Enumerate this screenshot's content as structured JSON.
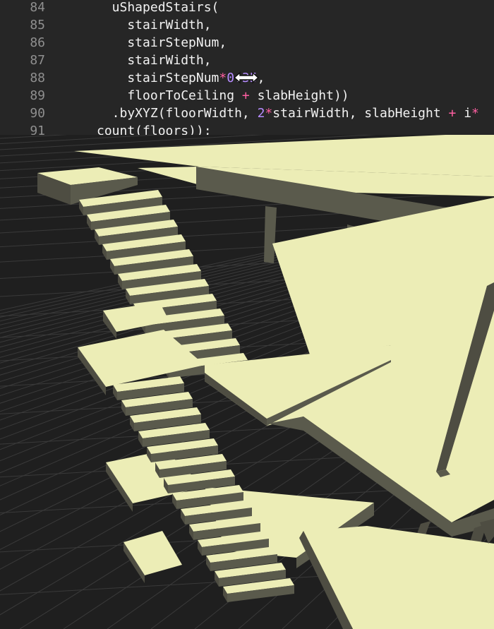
{
  "editor": {
    "lines": [
      {
        "num": "84",
        "tokens": [
          {
            "t": "  uShapedStairs(",
            "c": "plain"
          }
        ]
      },
      {
        "num": "85",
        "tokens": [
          {
            "t": "    stairWidth,",
            "c": "plain"
          }
        ]
      },
      {
        "num": "86",
        "tokens": [
          {
            "t": "    stairStepNum,",
            "c": "plain"
          }
        ]
      },
      {
        "num": "87",
        "tokens": [
          {
            "t": "    stairWidth,",
            "c": "plain"
          }
        ]
      },
      {
        "num": "88",
        "tokens": [
          {
            "t": "    stairStepNum",
            "c": "plain"
          },
          {
            "t": "*",
            "c": "op"
          },
          {
            "t": "0.35",
            "c": "num"
          },
          {
            "t": ",",
            "c": "plain"
          }
        ]
      },
      {
        "num": "89",
        "tokens": [
          {
            "t": "    floorToCeiling ",
            "c": "plain"
          },
          {
            "t": "+",
            "c": "op"
          },
          {
            "t": " slabHeight))",
            "c": "plain"
          }
        ]
      },
      {
        "num": "90",
        "tokens": [
          {
            "t": "  .byXYZ(floorWidth, ",
            "c": "plain"
          },
          {
            "t": "2",
            "c": "num"
          },
          {
            "t": "*",
            "c": "op"
          },
          {
            "t": "stairWidth, slabHeight ",
            "c": "plain"
          },
          {
            "t": "+",
            "c": "op"
          },
          {
            "t": " i",
            "c": "plain"
          },
          {
            "t": "*",
            "c": "op"
          }
        ]
      },
      {
        "num": "91",
        "tokens": [
          {
            "t": "count(floors));",
            "c": "plain"
          }
        ]
      }
    ],
    "cursor": "resize-horizontal-cursor-icon"
  },
  "viewport": {
    "background": "#1f1f1f",
    "grid_color": "#3a3a3a",
    "slab_top_color": "#ecedb6",
    "slab_side_color": "#4e4d42",
    "slab_front_color": "#5a5a4c"
  }
}
